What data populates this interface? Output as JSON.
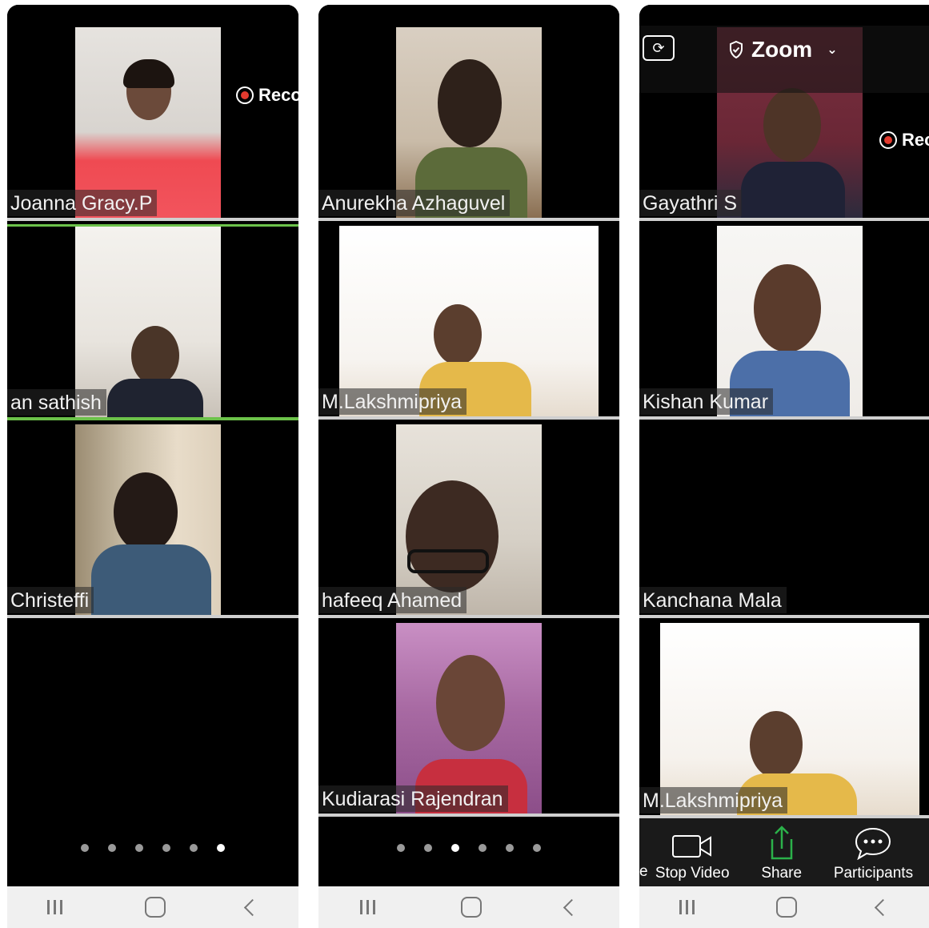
{
  "phones": [
    {
      "tiles": [
        {
          "name": "Joanna Gracy.P",
          "rec": "Reco"
        },
        {
          "name": "an sathish",
          "active": true
        },
        {
          "name": "Christeffi"
        },
        {
          "name": ""
        }
      ],
      "pager_active": 5
    },
    {
      "tiles": [
        {
          "name": "Anurekha Azhaguvel"
        },
        {
          "name": "M.Lakshmipriya"
        },
        {
          "name": "hafeeq Ahamed"
        },
        {
          "name": "Kudiarasi Rajendran"
        }
      ],
      "pager_active": 2
    },
    {
      "header": {
        "title": "Zoom",
        "rec": "Rec"
      },
      "tiles": [
        {
          "name": "Gayathri S"
        },
        {
          "name": "Kishan Kumar"
        },
        {
          "name": "Kanchana Mala"
        },
        {
          "name": "M.Lakshmipriya"
        }
      ],
      "toolbar": {
        "edge_label": "e",
        "stop_video": "Stop Video",
        "share": "Share",
        "participants": "Participants"
      }
    }
  ],
  "colors": {
    "active_speaker": "#6cc24a",
    "share_icon": "#2bb14a",
    "record": "#e33a2e"
  },
  "icons": [
    "record-icon",
    "camera-flip-icon",
    "shield-icon",
    "chevron-down-icon",
    "video-camera-icon",
    "share-upload-icon",
    "chat-bubble-icon",
    "recent-apps-icon",
    "home-icon",
    "back-icon"
  ]
}
